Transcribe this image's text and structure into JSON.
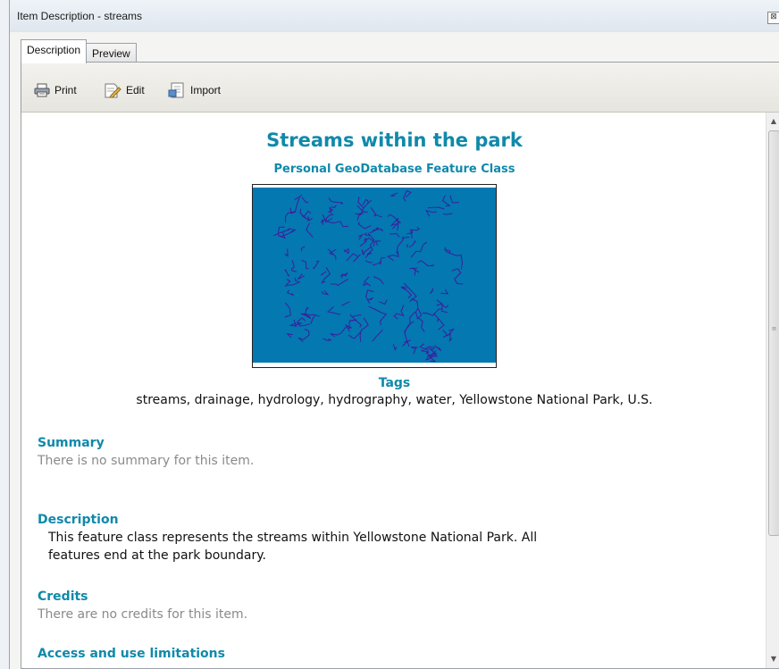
{
  "window": {
    "title": "Item Description - streams",
    "close_glyph": "⊠"
  },
  "tabs": [
    {
      "label": "Description",
      "active": true
    },
    {
      "label": "Preview",
      "active": false
    }
  ],
  "toolbar": {
    "print_label": "Print",
    "edit_label": "Edit",
    "import_label": "Import"
  },
  "document": {
    "title": "Streams within the park",
    "subtitle": "Personal GeoDatabase Feature Class",
    "thumbnail": {
      "background_color": "#0478b0",
      "stream_color": "#3a1f9e"
    },
    "tags_heading": "Tags",
    "tags": "streams, drainage, hydrology, hydrography, water, Yellowstone National Park, U.S.",
    "summary_heading": "Summary",
    "summary_text": "There is no summary for this item.",
    "description_heading": "Description",
    "description_line1": "This feature class represents the streams within Yellowstone National Park. All",
    "description_line2": "features end at the park boundary.",
    "credits_heading": "Credits",
    "credits_text": "There are no credits for this item.",
    "access_heading": "Access and use limitations"
  },
  "colors": {
    "heading": "#1089aa",
    "muted_text": "#8a8a8a"
  }
}
